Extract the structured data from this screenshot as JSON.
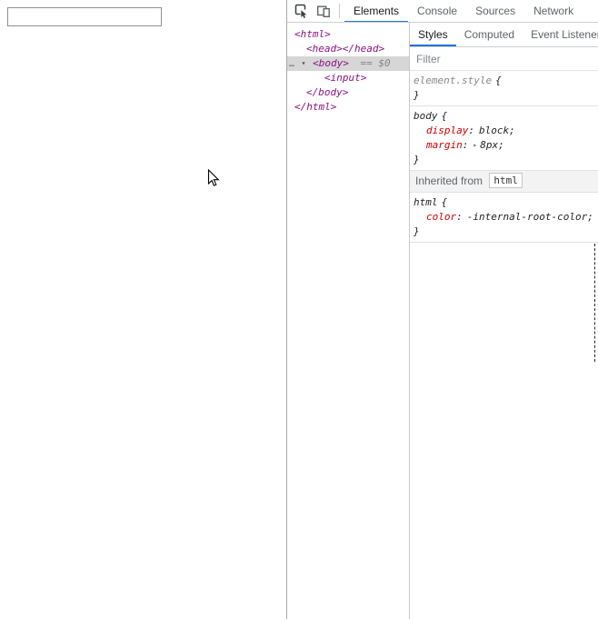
{
  "page": {
    "input": {
      "value": ""
    }
  },
  "devtools": {
    "toolbar": {
      "tabs": [
        {
          "label": "Elements",
          "active": true
        },
        {
          "label": "Console",
          "active": false
        },
        {
          "label": "Sources",
          "active": false
        },
        {
          "label": "Network",
          "active": false
        }
      ]
    },
    "dom_tree": {
      "nodes": [
        {
          "text": "<html>"
        },
        {
          "text": "<head></head>"
        },
        {
          "gutter": "…",
          "arrow": "▾",
          "text": "<body>",
          "marker": "== $0",
          "selected": true
        },
        {
          "text": "<input>"
        },
        {
          "text": "</body>"
        },
        {
          "text": "</html>"
        }
      ]
    },
    "styles_pane": {
      "tabs": [
        {
          "label": "Styles",
          "active": true
        },
        {
          "label": "Computed",
          "active": false
        },
        {
          "label": "Event Listeners",
          "active": false
        }
      ],
      "filter_placeholder": "Filter",
      "element_style": {
        "selector": "element.style"
      },
      "body_rule": {
        "selector": "body",
        "props": [
          {
            "name": "display",
            "value": "block;"
          },
          {
            "name": "margin",
            "expander": "▸",
            "value": "8px;"
          }
        ]
      },
      "inherited": {
        "label": "Inherited from",
        "link": "html"
      },
      "html_rule": {
        "selector": "html",
        "props": [
          {
            "name": "color",
            "value": "-internal-root-color;"
          }
        ]
      },
      "punct": {
        "colon": ":",
        "open": "{",
        "close": "}"
      }
    }
  }
}
